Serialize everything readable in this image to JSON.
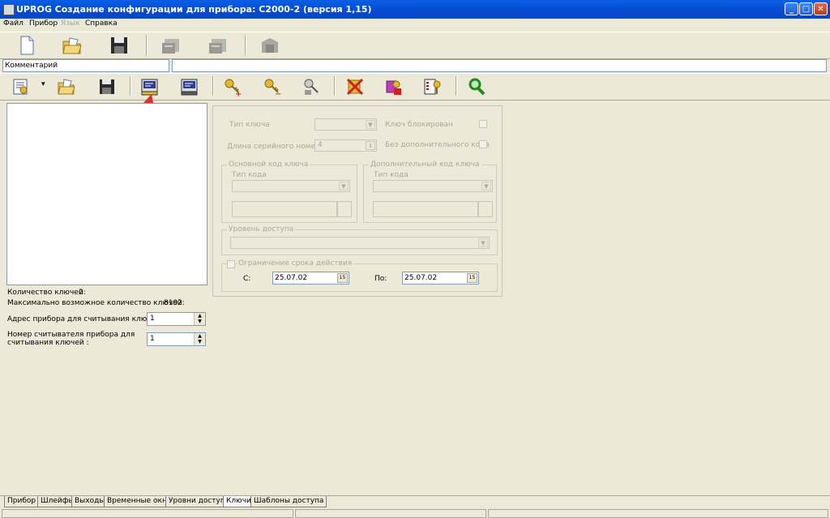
{
  "window": {
    "title": "UPROG  Создание конфигурации для прибора: С2000-2 (версия  1,15)"
  },
  "menu": {
    "items": [
      "Файл",
      "Прибор",
      "Язык",
      "Справка"
    ]
  },
  "comment": {
    "label": "Комментарий",
    "value": ""
  },
  "toolbar2": {
    "dropdown_arrow": "▾"
  },
  "keys": {
    "count_label": "Количество ключей:",
    "count_value": "0",
    "max_label": "Максимально возможное количество ключей:",
    "max_value": "8192",
    "addr_label": "Адрес прибора для считывания ключей :",
    "addr_value": "1",
    "reader_label_line1": "Номер считывателя прибора для",
    "reader_label_line2": "считывания ключей :",
    "reader_value": "1"
  },
  "key_panel": {
    "type_label": "Тип ключа",
    "serial_len_label": "Длина серийного номера",
    "serial_len_value": "4",
    "blocked_label": "Ключ блокирован",
    "no_extra_code_label": "Без дополнительного кода",
    "main_code_group": "Основной код ключа",
    "code_type_label": "Тип кода",
    "extra_code_group": "Дополнительный код ключа",
    "extra_code_type_label": "Тип кода",
    "access_level_group": "Уровень доступа",
    "expiry_label": "Ограничение срока действия",
    "from_label": "С:",
    "from_value": "25.07.02",
    "to_label": "По:",
    "to_value": "25.07.02",
    "cal_num": "15"
  },
  "tabs": [
    "Прибор",
    "Шлейфы",
    "Выходы",
    "Временные окна",
    "Уровни доступа",
    "Ключи",
    "Шаблоны доступа"
  ],
  "active_tab": "Ключи",
  "colors": {
    "titlebar": "#0550d8",
    "window_bg": "#ece9d8",
    "arrow": "#e03030"
  }
}
